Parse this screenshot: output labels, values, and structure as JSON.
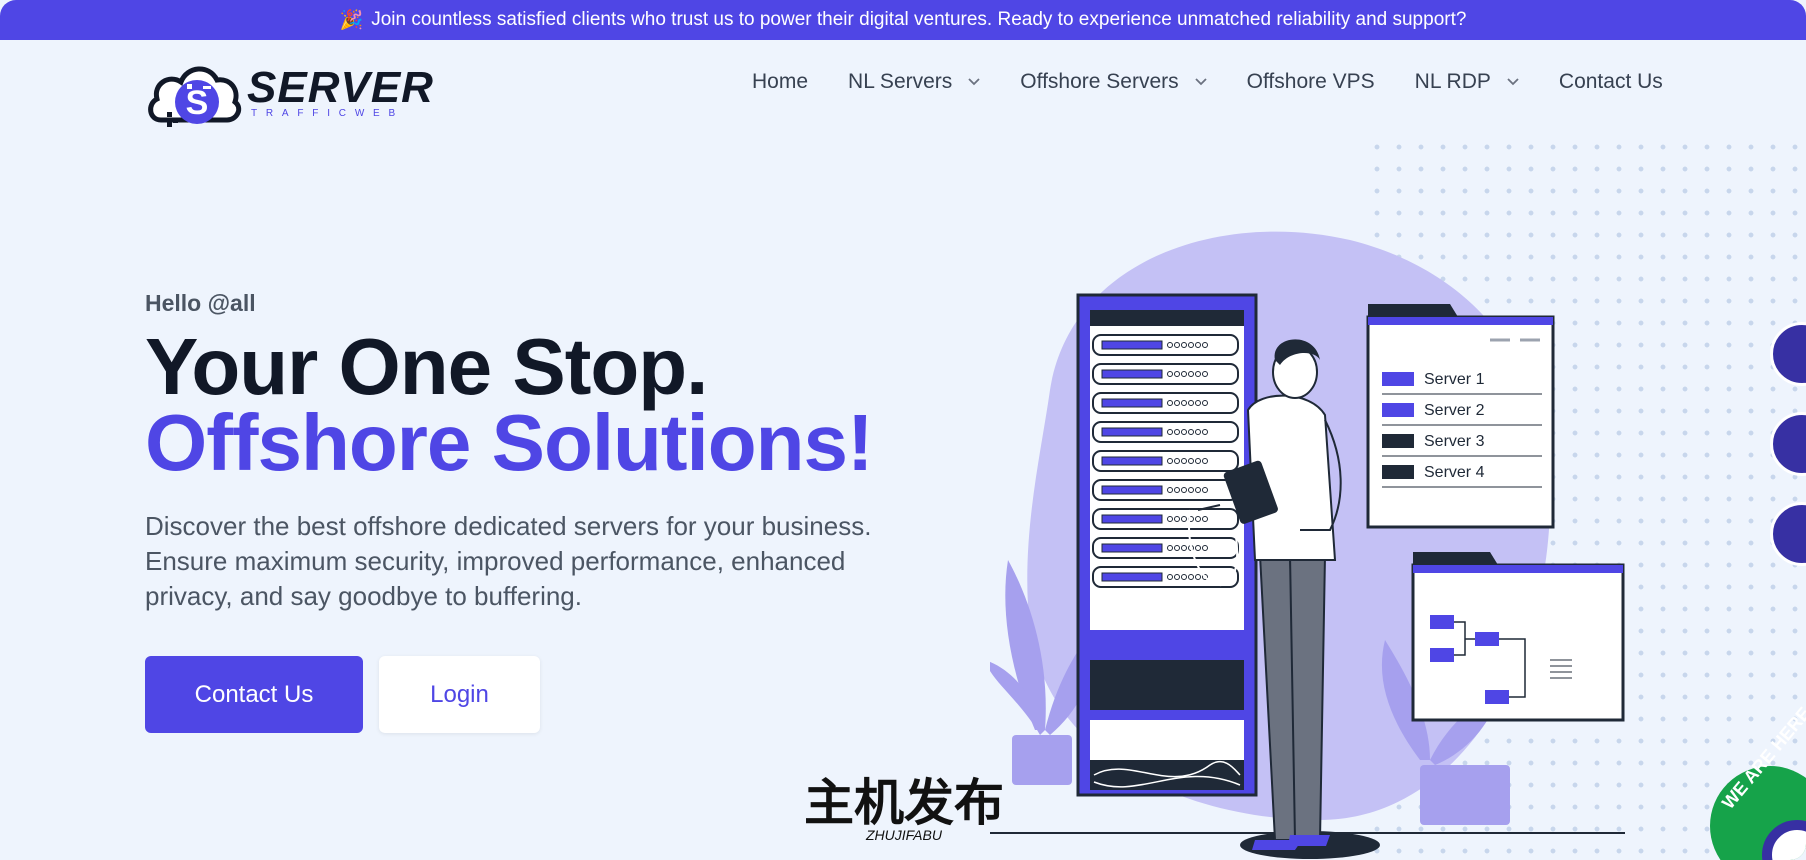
{
  "announcement": {
    "icon": "party-popper-icon",
    "icon_glyph": "🎉",
    "text": "Join countless satisfied clients who trust us to power their digital ventures. Ready to experience unmatched reliability and support?"
  },
  "brand": {
    "logo_text": "SERVER",
    "logo_subtext": "TRAFFICWEB",
    "logo_badge_letter": "S"
  },
  "nav": {
    "items": [
      {
        "label": "Home",
        "has_dropdown": false
      },
      {
        "label": "NL Servers",
        "has_dropdown": true
      },
      {
        "label": "Offshore Servers",
        "has_dropdown": true
      },
      {
        "label": "Offshore VPS",
        "has_dropdown": false
      },
      {
        "label": "NL RDP",
        "has_dropdown": true
      },
      {
        "label": "Contact Us",
        "has_dropdown": false
      }
    ]
  },
  "hero": {
    "greeting": "Hello @all",
    "title_line1": "Your One Stop.",
    "title_line2": "Offshore Solutions!",
    "description": "Discover the best offshore dedicated servers for your business. Ensure maximum security, improved performance, enhanced privacy, and say goodbye to buffering.",
    "primary_button": "Contact Us",
    "secondary_button": "Login"
  },
  "illustration": {
    "server_list": [
      "Server 1",
      "Server 2",
      "Server 3",
      "Server 4"
    ]
  },
  "side_contacts": {
    "icons": [
      "skype-icon",
      "telegram-icon",
      "gmail-icon"
    ]
  },
  "support_badge": {
    "text": "WE ARE HERE"
  },
  "watermark": {
    "chinese": "主机发布",
    "latin": "ZHUJIFABU"
  },
  "colors": {
    "accent": "#4f46e5",
    "background": "#eef4fd",
    "heading": "#111827",
    "body_text": "#4b5563",
    "blob": "#c4c1f5",
    "badge": "#16a34a"
  }
}
